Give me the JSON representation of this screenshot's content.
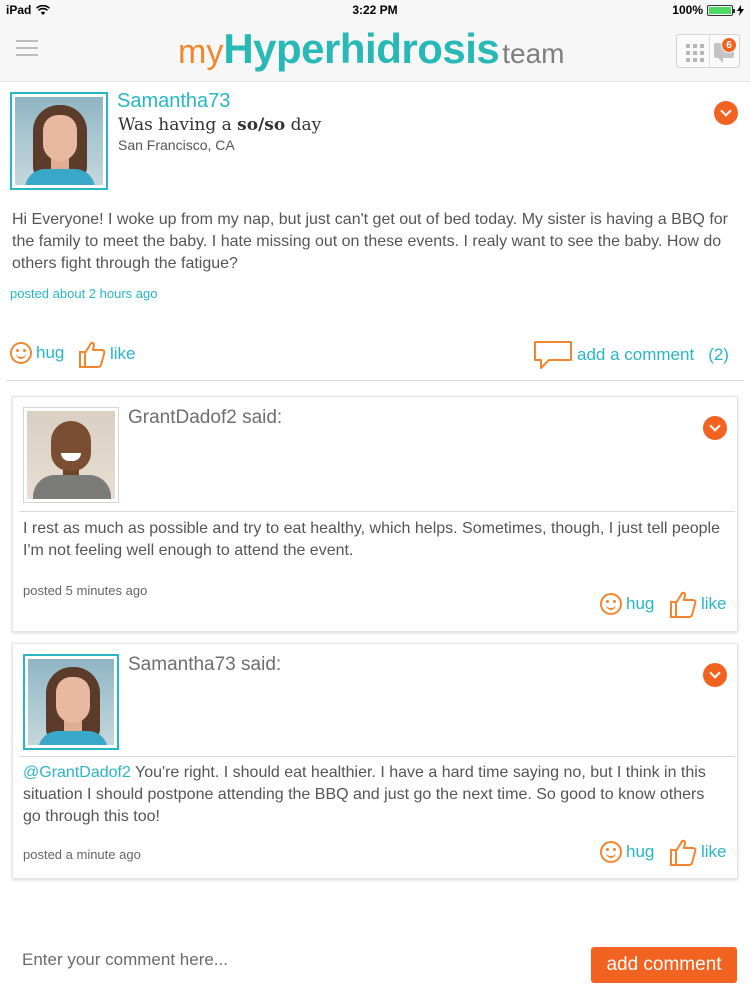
{
  "status_bar": {
    "device": "iPad",
    "time": "3:22 PM",
    "battery": "100%",
    "battery_level": 1.0
  },
  "header": {
    "logo_my": "my",
    "logo_main": "Hyperhidrosis",
    "logo_team": "team",
    "notification_count": "6"
  },
  "post": {
    "username": "Samantha73",
    "mood_prefix": "Was having a",
    "mood_value": "so/so",
    "mood_suffix": "day",
    "location": "San Francisco, CA",
    "body": "Hi Everyone! I woke up from my nap, but just can't get out of bed today. My sister is having a BBQ for the family to meet the baby. I hate missing out on these events. I realy want to see the baby. How do others fight through the fatigue?",
    "posted": "posted about 2 hours ago",
    "hug_label": "hug",
    "like_label": "like",
    "add_comment_label": "add a comment",
    "comment_count": "(2)"
  },
  "comments": [
    {
      "author_said": "GrantDadof2 said:",
      "body": "I rest as much as possible and try to eat healthy, which helps. Sometimes, though, I just tell people I'm not feeling well enough to attend the event.",
      "posted": "posted 5 minutes ago",
      "hug_label": "hug",
      "like_label": "like"
    },
    {
      "author_said": "Samantha73 said:",
      "mention": "@GrantDadof2",
      "body": "You're right. I should eat healthier. I have a hard time saying no, but I think in this situation I should postpone attending the BBQ and just go the next time. So good to know others go through this too!",
      "posted": "posted a minute ago",
      "hug_label": "hug",
      "like_label": "like"
    }
  ],
  "composer": {
    "placeholder": "Enter your comment here...",
    "button_label": "add comment"
  },
  "colors": {
    "teal": "#29b6c4",
    "orange": "#f26322",
    "logo_orange": "#f2862e"
  }
}
